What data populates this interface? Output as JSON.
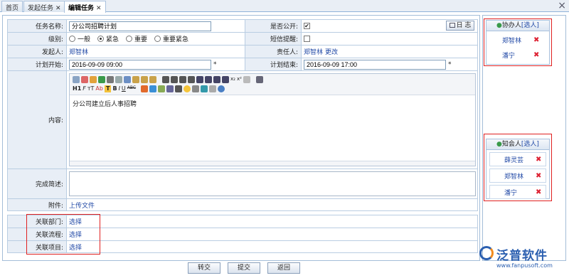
{
  "tabs": [
    {
      "label": "首页",
      "closable": false
    },
    {
      "label": "发起任务",
      "closable": true
    },
    {
      "label": "编辑任务",
      "closable": true
    }
  ],
  "close_all": "×",
  "form": {
    "task_name_label": "任务名称:",
    "task_name_value": "分公司招聘计划",
    "public_label": "是否公开:",
    "log_button": "日 志",
    "level_label": "级别:",
    "levels": [
      "一般",
      "紧急",
      "重要",
      "重要紧急"
    ],
    "level_selected": "紧急",
    "sms_label": "短信提醒:",
    "initiator_label": "发起人:",
    "initiator_value": "郑智林",
    "owner_label": "责任人:",
    "owner_value": "郑智林",
    "owner_change": "更改",
    "start_label": "计划开始:",
    "start_value": "2016-09-09 09:00",
    "end_label": "计划结束:",
    "end_value": "2016-09-09 17:00",
    "required_mark": "*",
    "content_label": "内容:",
    "content_text": "分公司建立后人事招聘",
    "summary_label": "完成简述:",
    "attachment_label": "附件:",
    "attachment_link": "上传文件",
    "dept_label": "关联部门:",
    "flow_label": "关联流程:",
    "project_label": "关联项目:",
    "select_link": "选择"
  },
  "editor_toolbar": {
    "heading": "H1",
    "font": "F",
    "size": "тT",
    "ab": "Ab",
    "bold": "B",
    "italic": "I",
    "underline": "U",
    "strike": "ABC",
    "sub": "x₂",
    "sup": "x²"
  },
  "buttons": {
    "transfer": "转交",
    "submit": "提交",
    "back": "返回"
  },
  "assist": {
    "title": "协办人",
    "select": "[选人]",
    "people": [
      "郑智林",
      "潘宁"
    ]
  },
  "notify": {
    "title": "知会人",
    "select": "[选人]",
    "people": [
      "薛灵芸",
      "郑智林",
      "潘宁"
    ]
  },
  "logo": {
    "text": "泛普软件",
    "url": "www.fanpusoft.com"
  },
  "colors": {
    "accent": "#2149a6",
    "highlight_box": "#e02020",
    "label_bg": "#e8eef6"
  }
}
